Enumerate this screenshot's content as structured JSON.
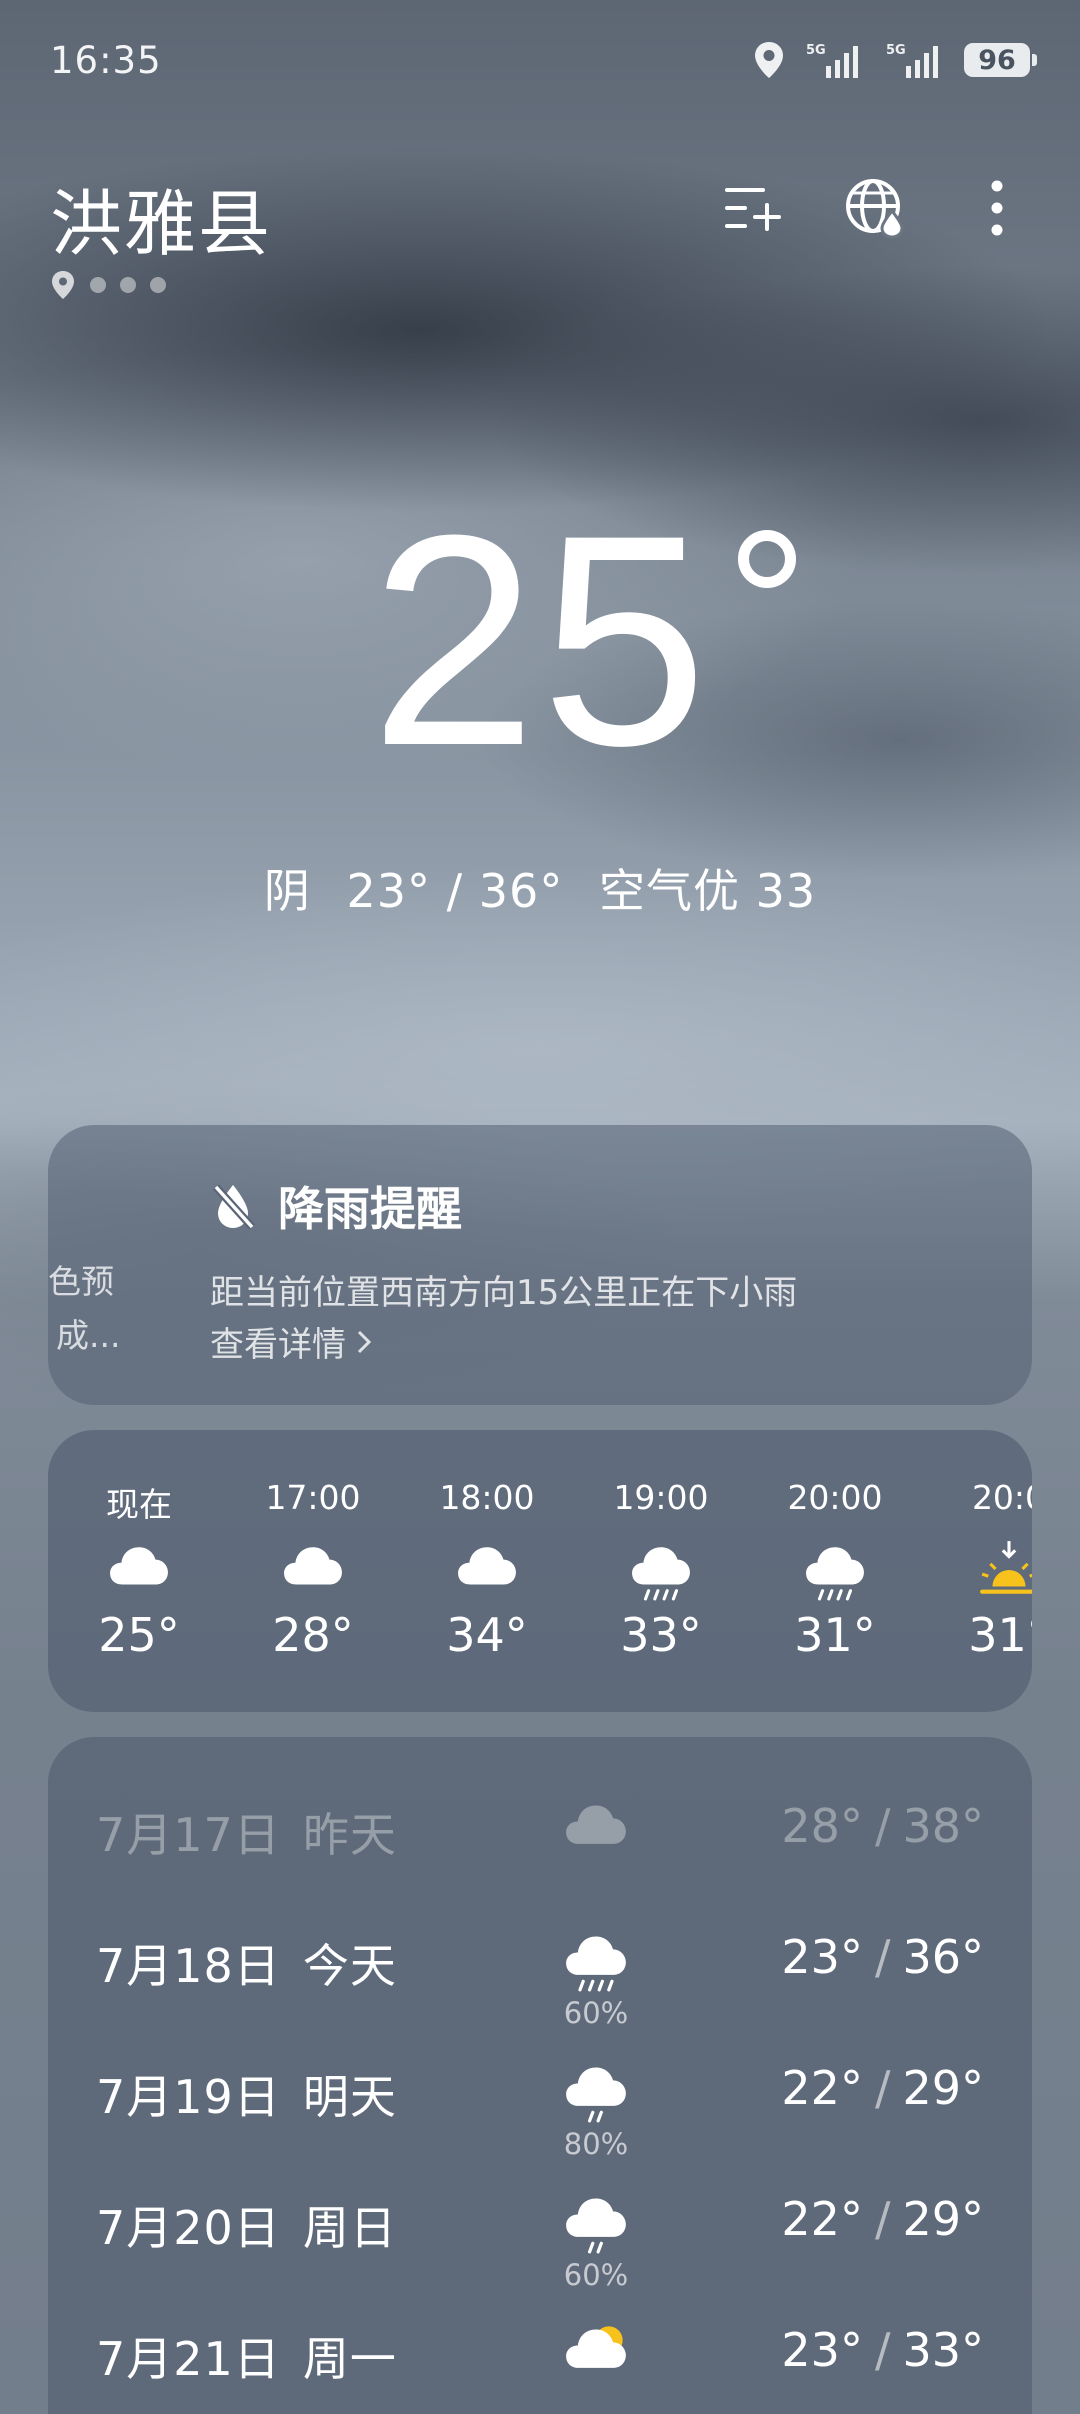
{
  "status_bar": {
    "time": "16:35",
    "net1": "5G",
    "net2": "5G",
    "battery": "96"
  },
  "header": {
    "city": "洪雅县",
    "page_count": 4,
    "actions": [
      "add-city",
      "global-weather",
      "more"
    ]
  },
  "current": {
    "temp": "25",
    "condition": "阴",
    "low_high": "23° / 36°",
    "air_quality": "空气优 33"
  },
  "rain_alert": {
    "partial_left_line1": "色预",
    "partial_left_line2": "成...",
    "title": "降雨提醒",
    "description": "距当前位置西南方向15公里正在下小雨",
    "link": "查看详情"
  },
  "hourly": [
    {
      "time": "现在",
      "icon": "cloud-icon",
      "temp": "25°"
    },
    {
      "time": "17:00",
      "icon": "cloud-icon",
      "temp": "28°"
    },
    {
      "time": "18:00",
      "icon": "cloud-icon",
      "temp": "34°"
    },
    {
      "time": "19:00",
      "icon": "rain-cloud-icon",
      "temp": "33°"
    },
    {
      "time": "20:00",
      "icon": "rain-cloud-icon",
      "temp": "31°"
    },
    {
      "time": "20:0",
      "icon": "sunset-icon",
      "temp": "31°"
    }
  ],
  "daily": [
    {
      "date": "7月17日",
      "weekday": "昨天",
      "icon": "cloud-icon",
      "precip": "",
      "low": "28°",
      "high": "38°",
      "past": true
    },
    {
      "date": "7月18日",
      "weekday": "今天",
      "icon": "heavy-rain-icon",
      "precip": "60%",
      "low": "23°",
      "high": "36°",
      "past": false
    },
    {
      "date": "7月19日",
      "weekday": "明天",
      "icon": "light-rain-icon",
      "precip": "80%",
      "low": "22°",
      "high": "29°",
      "past": false
    },
    {
      "date": "7月20日",
      "weekday": "周日",
      "icon": "light-rain-icon",
      "precip": "60%",
      "low": "22°",
      "high": "29°",
      "past": false
    },
    {
      "date": "7月21日",
      "weekday": "周一",
      "icon": "partly-cloudy-icon",
      "precip": "",
      "low": "23°",
      "high": "33°",
      "past": false
    }
  ]
}
